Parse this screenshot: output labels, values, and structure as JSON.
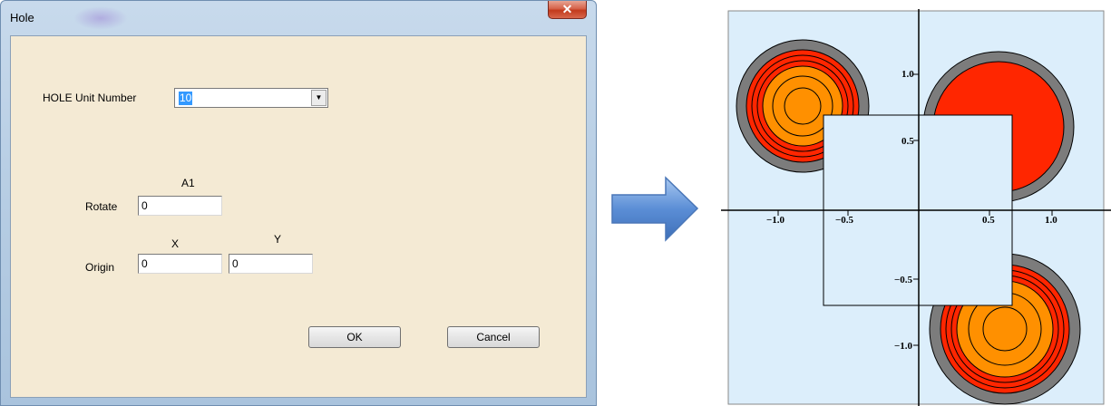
{
  "dialog": {
    "title": "Hole",
    "close_glyph": "✕",
    "unit_label": "HOLE  Unit Number",
    "unit_value": "10",
    "a1_header": "A1",
    "rotate_label": "Rotate",
    "rotate_value": "0",
    "x_header": "X",
    "y_header": "Y",
    "origin_label": "Origin",
    "origin_x": "0",
    "origin_y": "0",
    "ok_label": "OK",
    "cancel_label": "Cancel",
    "dropdown_icon": "▼"
  },
  "arrow": {
    "icon": "right-arrow-icon",
    "color": "#5b8ed6"
  },
  "plot": {
    "xticks": [
      "−1.0",
      "−0.5",
      "0.5",
      "1.0"
    ],
    "yticks": [
      "1.0",
      "0.5",
      "−0.5",
      "−1.0"
    ],
    "colors": {
      "background": "#dceefb",
      "ring_gray": "#7c7c7c",
      "red": "#ff2600",
      "orange": "#ff9000",
      "square": "#dceefb"
    }
  }
}
